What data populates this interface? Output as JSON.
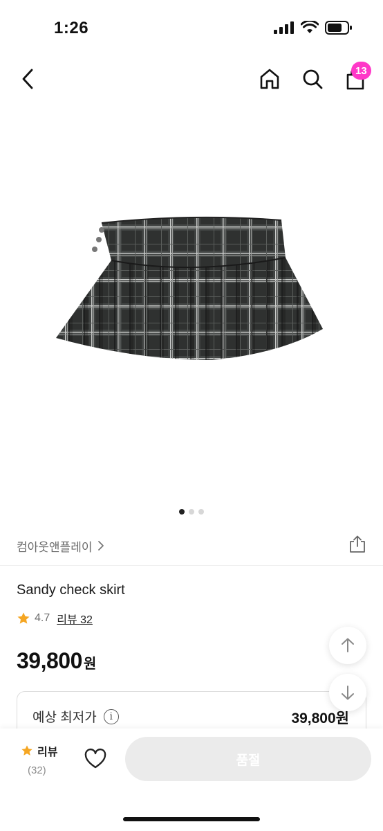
{
  "status_bar": {
    "time": "1:26"
  },
  "nav": {
    "cart_count": "13"
  },
  "gallery": {
    "page_count": 3,
    "active_index": 0
  },
  "brand": {
    "name": "컴아웃앤플레이"
  },
  "product": {
    "name": "Sandy check skirt",
    "rating": "4.7",
    "review_link": "리뷰 32",
    "price": "39,800",
    "price_unit": "원"
  },
  "lowest_price": {
    "label": "예상 최저가",
    "info_glyph": "i",
    "value": "39,800원"
  },
  "bottom_bar": {
    "review_label": "리뷰",
    "review_count": "(32)",
    "buy_button": "품절"
  },
  "colors": {
    "accent_badge": "#ff38c8",
    "star": "#f5a623",
    "disabled_button": "#ebebeb"
  }
}
